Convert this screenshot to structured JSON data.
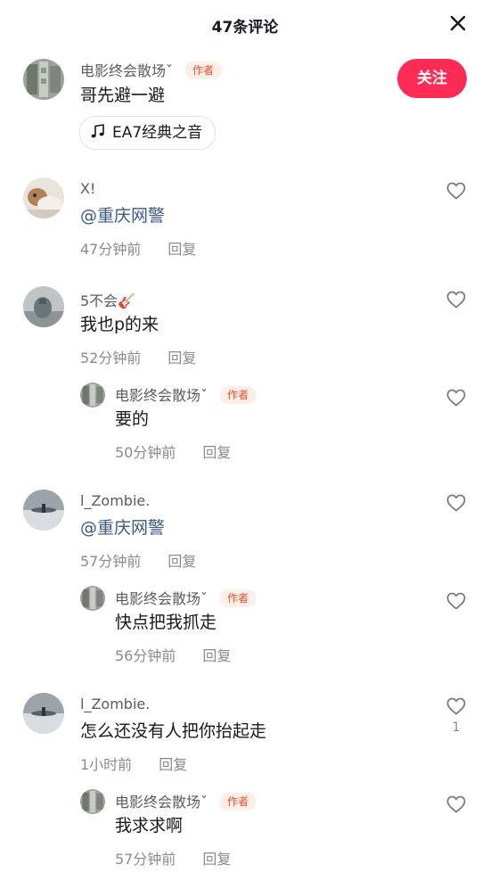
{
  "header": {
    "title": "47条评论",
    "close_icon": "close-icon"
  },
  "colors": {
    "follow_button": "#fe2c55",
    "author_badge_text": "#fe4c2c",
    "mention": "#3b5a8a"
  },
  "post": {
    "nickname": "电影终会散场ˇ",
    "badge": "作者",
    "text": "哥先避一避",
    "follow_label": "关注",
    "music_label": "EA7经典之音",
    "music_icon": "music-note-icon"
  },
  "comments": [
    {
      "nickname": "X!",
      "text": "@重庆网警",
      "time": "47分钟前",
      "reply_label": "回复",
      "replies": []
    },
    {
      "nickname": "5不会🎸",
      "text": "我也p的来",
      "time": "52分钟前",
      "reply_label": "回复",
      "replies": [
        {
          "nickname": "电影终会散场ˇ",
          "badge": "作者",
          "text": "要的",
          "time": "50分钟前",
          "reply_label": "回复"
        }
      ]
    },
    {
      "nickname": "l_Zombie.",
      "text": "@重庆网警",
      "time": "57分钟前",
      "reply_label": "回复",
      "replies": [
        {
          "nickname": "电影终会散场ˇ",
          "badge": "作者",
          "text": "快点把我抓走",
          "time": "56分钟前",
          "reply_label": "回复"
        }
      ]
    },
    {
      "nickname": "l_Zombie.",
      "text": "怎么还没有人把你抬起走",
      "time": "1小时前",
      "reply_label": "回复",
      "like_count": "1",
      "replies": [
        {
          "nickname": "电影终会散场ˇ",
          "badge": "作者",
          "text": "我求求啊",
          "time": "57分钟前",
          "reply_label": "回复"
        }
      ]
    }
  ]
}
